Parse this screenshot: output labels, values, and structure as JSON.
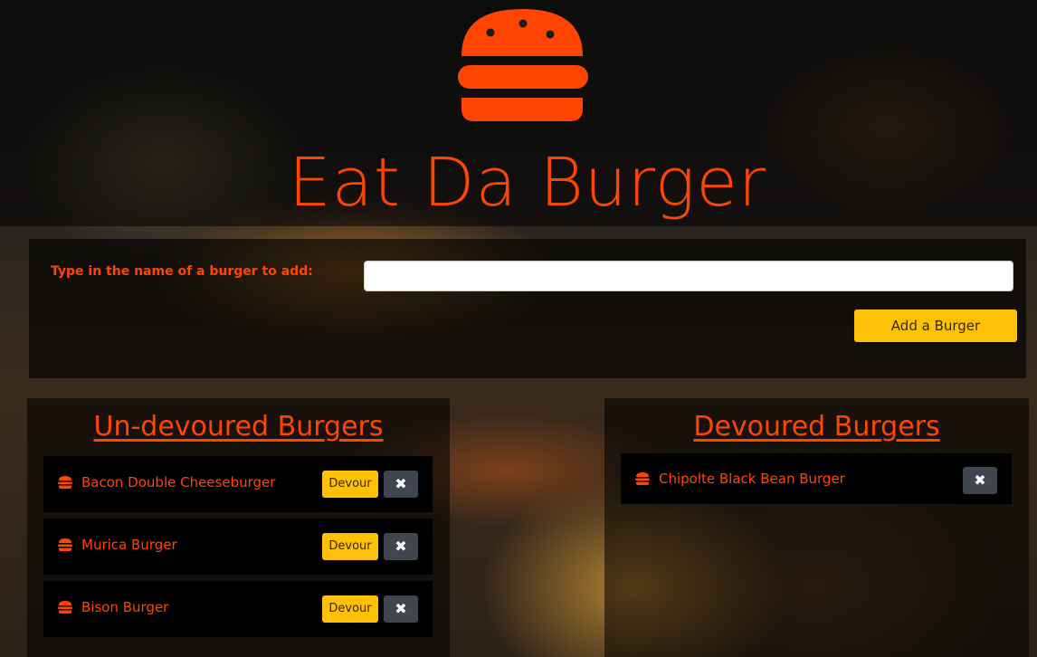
{
  "header": {
    "logo_icon": "burger-icon",
    "title": "Eat Da Burger"
  },
  "form": {
    "label": "Type in the name of a burger to add:",
    "input_value": "",
    "input_placeholder": "",
    "submit_label": "Add a Burger"
  },
  "undevoured": {
    "heading": "Un-devoured Burgers",
    "items": [
      {
        "name": "Bacon Double Cheeseburger",
        "devour_label": "Devour",
        "delete_label": "✖"
      },
      {
        "name": "Murica Burger",
        "devour_label": "Devour",
        "delete_label": "✖"
      },
      {
        "name": "Bison Burger",
        "devour_label": "Devour",
        "delete_label": "✖"
      }
    ]
  },
  "devoured": {
    "heading": "Devoured Burgers",
    "items": [
      {
        "name": "Chipolte Black Bean Burger",
        "delete_label": "✖"
      }
    ]
  },
  "colors": {
    "accent": "#ff4500",
    "button": "#ffc107",
    "delete_button": "#3f4650"
  }
}
